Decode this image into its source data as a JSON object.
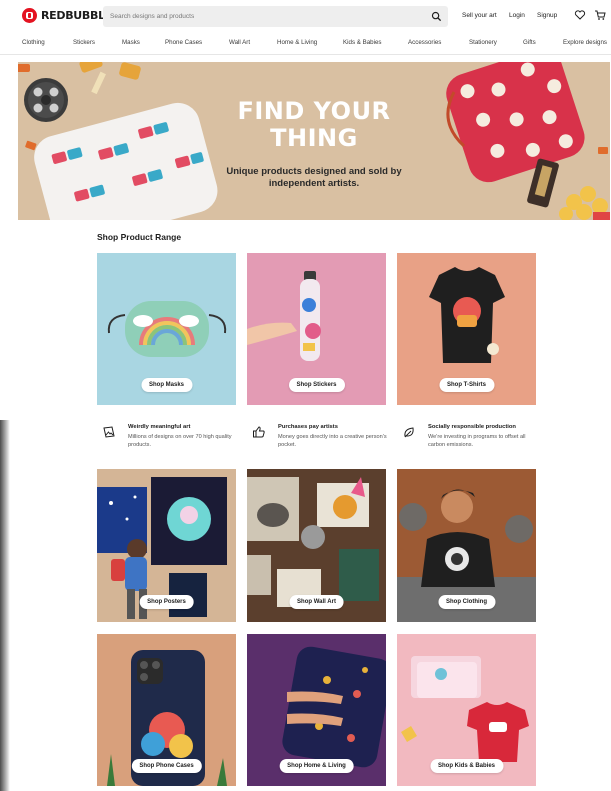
{
  "header": {
    "brand": "REDBUBBLE",
    "search_placeholder": "Search designs and products",
    "sell_link": "Sell your art",
    "login_link": "Login",
    "signup_link": "Signup"
  },
  "nav": {
    "items": [
      "Clothing",
      "Stickers",
      "Masks",
      "Phone Cases",
      "Wall Art",
      "Home & Living",
      "Kids & Babies",
      "Accessories",
      "Stationery",
      "Gifts",
      "Explore designs"
    ]
  },
  "hero": {
    "title_line1": "FIND YOUR",
    "title_line2": "THING",
    "subtitle_line1": "Unique products designed and sold by",
    "subtitle_line2": "independent artists."
  },
  "section": {
    "title": "Shop Product Range"
  },
  "tiles": [
    {
      "label": "Shop Masks",
      "bg": "#a9d6e2"
    },
    {
      "label": "Shop Stickers",
      "bg": "#e39bb4"
    },
    {
      "label": "Shop T-Shirts",
      "bg": "#e8a186"
    },
    {
      "label": "Shop Posters",
      "bg": "#d4b596"
    },
    {
      "label": "Shop Wall Art",
      "bg": "#5b3f2d"
    },
    {
      "label": "Shop Clothing",
      "bg": "#9c5a34"
    },
    {
      "label": "Shop Phone Cases",
      "bg": "#d8a07c"
    },
    {
      "label": "Shop Home & Living",
      "bg": "#5a2f6b"
    },
    {
      "label": "Shop Kids & Babies",
      "bg": "#f2b9c0"
    }
  ],
  "features": [
    {
      "icon": "image-icon",
      "title": "Weirdly meaningful art",
      "desc": "Millions of designs on over 70 high quality products."
    },
    {
      "icon": "thumbs-up-icon",
      "title": "Purchases pay artists",
      "desc": "Money goes directly into a creative person's pocket."
    },
    {
      "icon": "leaf-icon",
      "title": "Socially responsible production",
      "desc": "We're investing in programs to offset all carbon emissions."
    }
  ],
  "colors": {
    "brand": "#e41321",
    "hero_bg": "#d9c0a2"
  }
}
